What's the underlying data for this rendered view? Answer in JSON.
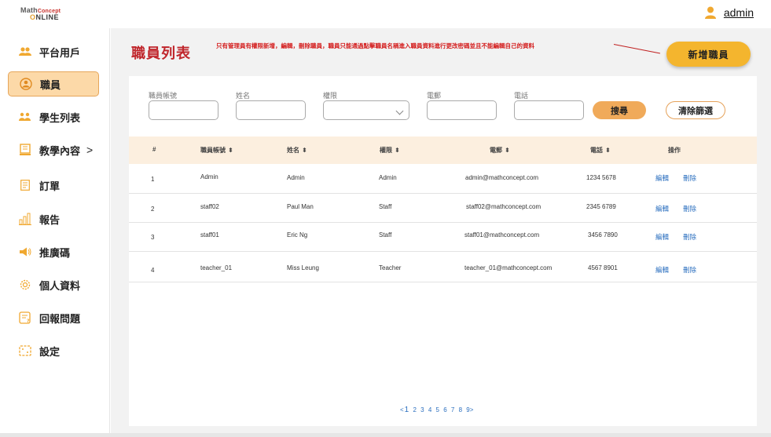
{
  "logo": {
    "line1_big": "Math",
    "line1_small": "Concept",
    "line2_o": "O",
    "line2_rest": "NLINE"
  },
  "user": {
    "name": "admin"
  },
  "sidebar": {
    "items": [
      {
        "label": "平台用戶",
        "icon": "users-icon"
      },
      {
        "label": "職員",
        "icon": "staff-icon",
        "active": true
      },
      {
        "label": "學生列表",
        "icon": "students-icon"
      },
      {
        "label": "教學內容",
        "icon": "book-icon",
        "chevron": ">"
      },
      {
        "label": "訂單",
        "icon": "order-icon"
      },
      {
        "label": "報告",
        "icon": "chart-icon"
      },
      {
        "label": "推廣碼",
        "icon": "megaphone-icon"
      },
      {
        "label": "個人資料",
        "icon": "gear-icon"
      },
      {
        "label": "回報問題",
        "icon": "feedback-icon"
      },
      {
        "label": "設定",
        "icon": "settings-icon"
      }
    ]
  },
  "page": {
    "title": "職員列表",
    "note": "只有管理員有權限新增，編輯，刪除職員，職員只能通過點擊職員名稱進入職員資料進行更改密碼並且不能編輯自己的資料",
    "add_button": "新增職員"
  },
  "filters": {
    "account_label": "職員帳號",
    "name_label": "姓名",
    "role_label": "權限",
    "email_label": "電郵",
    "phone_label": "電話",
    "search_button": "搜尋",
    "clear_button": "清除篩選"
  },
  "table": {
    "headers": [
      "#",
      "職員帳號",
      "姓名",
      "權限",
      "電郵",
      "電話",
      "操作"
    ],
    "sort_glyph": "⬍",
    "rows": [
      {
        "no": "1",
        "account": "Admin",
        "name": "Admin",
        "role": "Admin",
        "email": "admin@mathconcept.com",
        "phone": "1234 5678",
        "edit": "編輯",
        "delete": "刪除"
      },
      {
        "no": "2",
        "account": "staff02",
        "name": "Paul Man",
        "role": "Staff",
        "email": "staff02@mathconcept.com",
        "phone": "2345 6789",
        "edit": "編輯",
        "delete": "刪除"
      },
      {
        "no": "3",
        "account": "staff01",
        "name": "Eric Ng",
        "role": "Staff",
        "email": "staff01@mathconcept.com",
        "phone": "3456 7890",
        "edit": "編輯",
        "delete": "刪除"
      },
      {
        "no": "4",
        "account": "teacher_01",
        "name": "Miss Leung",
        "role": "Teacher",
        "email": "teacher_01@mathconcept.com",
        "phone": "4567 8901",
        "edit": "編輯",
        "delete": "刪除"
      }
    ]
  },
  "pagination": {
    "prev": "<",
    "current": "1",
    "pages": [
      "2",
      "3",
      "4",
      "5",
      "6",
      "7",
      "8",
      "9"
    ],
    "next": ">"
  },
  "colors": {
    "accent": "#f4b52e",
    "title_red": "#c0262c",
    "link_blue": "#2b6fbf",
    "header_bg": "#fcefdf"
  }
}
